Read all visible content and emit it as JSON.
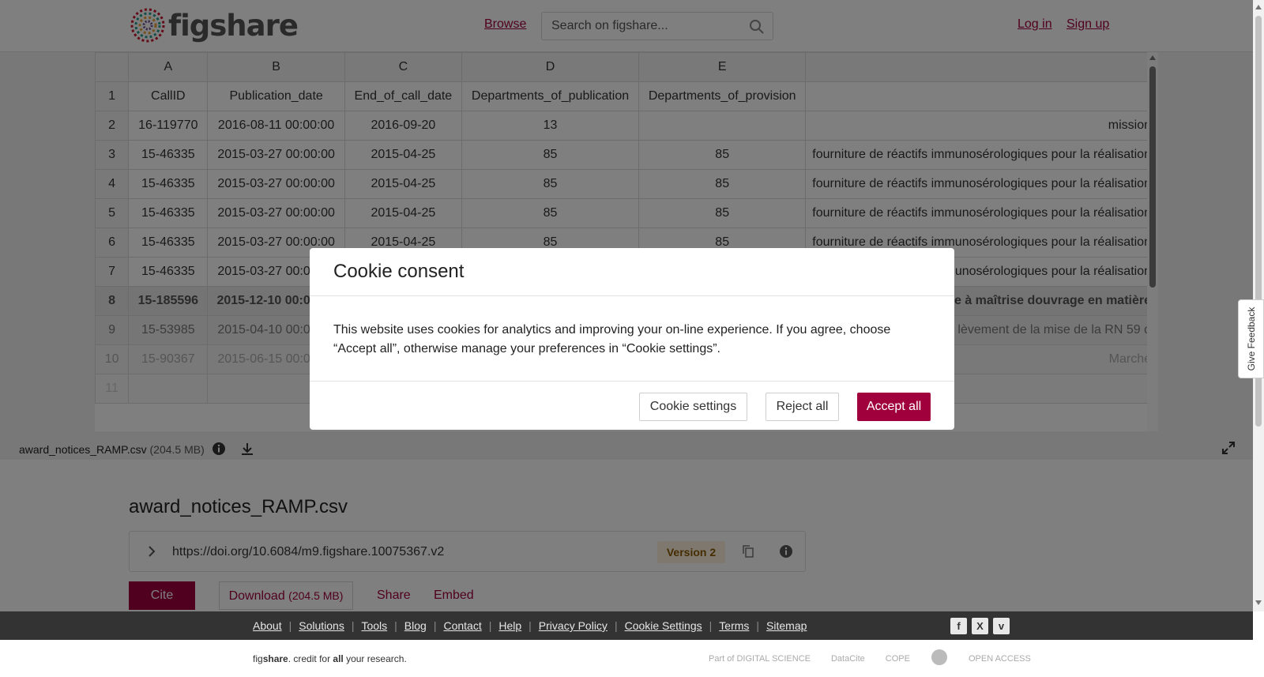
{
  "header": {
    "logo_text": "figshare",
    "browse_label": "Browse",
    "search_placeholder": "Search on figshare...",
    "login_label": "Log in",
    "signup_label": "Sign up"
  },
  "grid": {
    "columns": [
      "",
      "A",
      "B",
      "C",
      "D",
      "E",
      ""
    ],
    "rows": [
      [
        "1",
        "CallID",
        "Publication_date",
        "End_of_call_date",
        "Departments_of_publication",
        "Departments_of_provision",
        ""
      ],
      [
        "2",
        "16-119770",
        "2016-08-11 00:00:00",
        "2016-09-20",
        "13",
        "",
        "mission"
      ],
      [
        "3",
        "15-46335",
        "2015-03-27 00:00:00",
        "2015-04-25",
        "85",
        "85",
        "fourniture de réactifs immunosérologiques pour la réalisation"
      ],
      [
        "4",
        "15-46335",
        "2015-03-27 00:00:00",
        "2015-04-25",
        "85",
        "85",
        "fourniture de réactifs immunosérologiques pour la réalisation"
      ],
      [
        "5",
        "15-46335",
        "2015-03-27 00:00:00",
        "2015-04-25",
        "85",
        "85",
        "fourniture de réactifs immunosérologiques pour la réalisation"
      ],
      [
        "6",
        "15-46335",
        "2015-03-27 00:00:00",
        "2015-04-25",
        "85",
        "85",
        "fourniture de réactifs immunosérologiques pour la réalisation"
      ],
      [
        "7",
        "15-46335",
        "2015-03-27 00:00:00",
        "",
        "",
        "",
        "immunosérologiques pour la réalisation"
      ],
      [
        "8",
        "15-185596",
        "2015-12-10 00:00:00",
        "",
        "",
        "",
        "ce à maîtrise douvrage en matière"
      ],
      [
        "9",
        "15-53985",
        "2015-04-10 00:00:00",
        "",
        "",
        "",
        "lèvement de la mise de la RN 59 d"
      ],
      [
        "10",
        "15-90367",
        "2015-06-15 00:00:00",
        "",
        "",
        "",
        "Marché"
      ],
      [
        "11",
        "",
        "",
        "",
        "",
        "",
        ""
      ]
    ]
  },
  "file_bar": {
    "file_name": "award_notices_RAMP.csv",
    "file_size": "(204.5 MB)"
  },
  "item": {
    "title": "award_notices_RAMP.csv",
    "doi": "https://doi.org/10.6084/m9.figshare.10075367.v2",
    "version": "Version 2",
    "cite_label": "Cite",
    "download_label": "Download",
    "download_size": "(204.5 MB)",
    "share_label": "Share",
    "embed_label": "Embed"
  },
  "footer": {
    "links": [
      "About",
      "Solutions",
      "Tools",
      "Blog",
      "Contact",
      "Help",
      "Privacy Policy",
      "Cookie Settings",
      "Terms",
      "Sitemap"
    ],
    "tagline_pre": "fig",
    "tagline_bold": "share",
    "tagline_mid": ". credit for ",
    "tagline_bold2": "all",
    "tagline_post": " your research.",
    "social": [
      "facebook-icon",
      "x-icon",
      "vimeo-icon"
    ],
    "partners": [
      "Part of DIGITAL SCIENCE",
      "DataCite",
      "COPE",
      "",
      "OPEN ACCESS"
    ]
  },
  "feedback_label": "Give Feedback",
  "cookie": {
    "title": "Cookie consent",
    "text": "This website uses cookies for analytics and improving your on-line experience. If you agree, choose “Accept all”, otherwise manage your preferences in “Cookie settings”.",
    "settings_label": "Cookie settings",
    "reject_label": "Reject all",
    "accept_label": "Accept all"
  },
  "colors": {
    "brand": "#a0003c",
    "version_bg": "#fdf0dc",
    "footer_bg": "#333333"
  }
}
